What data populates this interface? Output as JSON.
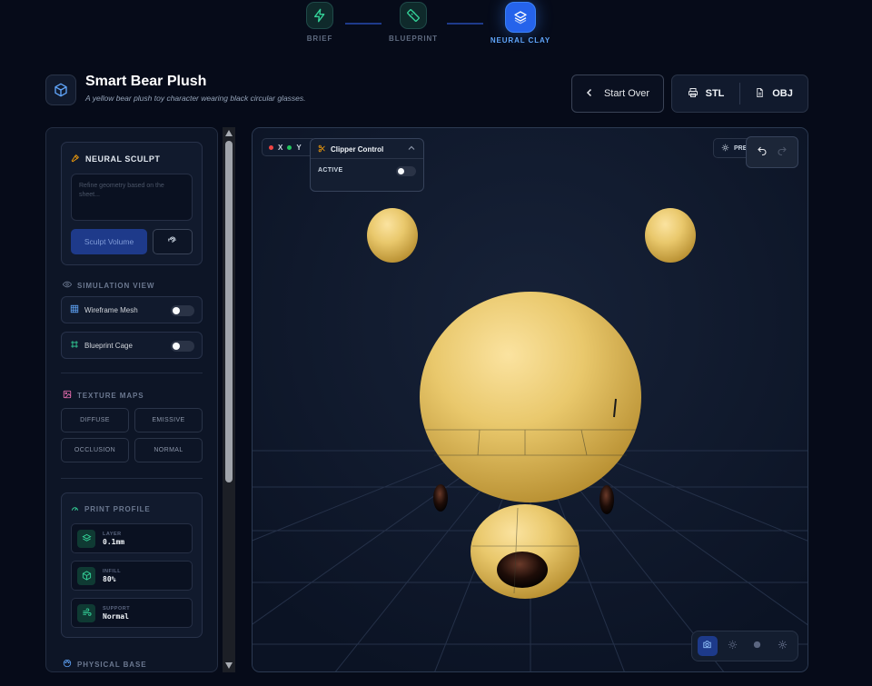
{
  "stepper": {
    "steps": [
      {
        "label": "BRIEF",
        "icon": "zap-icon"
      },
      {
        "label": "BLUEPRINT",
        "icon": "ruler-icon"
      },
      {
        "label": "NEURAL CLAY",
        "icon": "layers-icon"
      }
    ],
    "active_step": 2
  },
  "header": {
    "title": "Smart Bear Plush",
    "description": "A yellow bear plush toy character wearing black circular glasses.",
    "start_over_label": "Start Over",
    "export_stl_label": "STL",
    "export_obj_label": "OBJ"
  },
  "sidebar": {
    "sculpt": {
      "title": "NEURAL SCULPT",
      "placeholder": "Refine geometry based on the sheet...",
      "button_label": "Sculpt Volume"
    },
    "simulation": {
      "title": "SIMULATION VIEW",
      "toggles": [
        {
          "label": "Wireframe Mesh",
          "on": false
        },
        {
          "label": "Blueprint Cage",
          "on": false
        }
      ]
    },
    "texture": {
      "title": "TEXTURE MAPS",
      "buttons": [
        "DIFFUSE",
        "EMISSIVE",
        "OCCLUSION",
        "NORMAL"
      ]
    },
    "print_profile": {
      "title": "PRINT PROFILE",
      "rows": [
        {
          "label": "LAYER",
          "value": "0.1mm"
        },
        {
          "label": "INFILL",
          "value": "80%"
        },
        {
          "label": "SUPPORT",
          "value": "Normal"
        }
      ]
    },
    "physical_base": {
      "title": "PHYSICAL BASE"
    }
  },
  "viewport": {
    "axes": [
      "X",
      "Y"
    ],
    "clipper": {
      "title": "Clipper Control",
      "active_label": "ACTIVE",
      "active": false
    },
    "preview_label": "PRE"
  },
  "colors": {
    "accent": "#2563eb",
    "teal": "#34d399",
    "bear_yellow": "#e8c66a",
    "background": "#060b19"
  }
}
